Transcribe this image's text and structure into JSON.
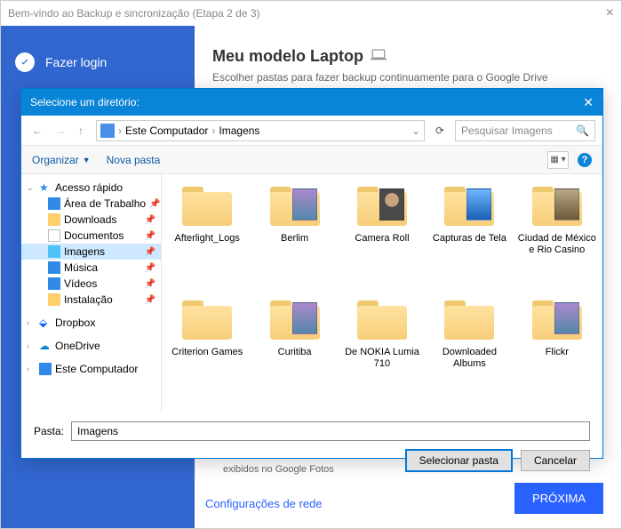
{
  "window": {
    "title": "Bem-vindo ao Backup e sincronização (Etapa 2 de 3)"
  },
  "sidebar": {
    "login_label": "Fazer login"
  },
  "main": {
    "title": "Meu modelo Laptop",
    "subtitle": "Escolher pastas para fazer backup continuamente para o Google Drive",
    "partial_text": "exibidos no Google Fotos",
    "network_link": "Configurações de rede",
    "next_button": "PRÓXIMA"
  },
  "dialog": {
    "title": "Selecione um diretório:",
    "breadcrumb": {
      "root": "Este Computador",
      "current": "Imagens"
    },
    "search_placeholder": "Pesquisar Imagens",
    "toolbar": {
      "organize": "Organizar",
      "new_folder": "Nova pasta"
    },
    "tree": {
      "quick_access": "Acesso rápido",
      "items": [
        {
          "label": "Área de Trabalho",
          "icon": "desktop"
        },
        {
          "label": "Downloads",
          "icon": "folder"
        },
        {
          "label": "Documentos",
          "icon": "docs"
        },
        {
          "label": "Imagens",
          "icon": "pictures"
        },
        {
          "label": "Música",
          "icon": "music"
        },
        {
          "label": "Vídeos",
          "icon": "video"
        },
        {
          "label": "Instalação",
          "icon": "folder"
        }
      ],
      "dropbox": "Dropbox",
      "onedrive": "OneDrive",
      "this_pc": "Este Computador"
    },
    "folders": [
      {
        "label": "Afterlight_Logs",
        "preview": false
      },
      {
        "label": "Berlim",
        "preview": true,
        "thumb": "photo"
      },
      {
        "label": "Camera Roll",
        "preview": true,
        "thumb": "face"
      },
      {
        "label": "Capturas de Tela",
        "preview": true,
        "thumb": "blue"
      },
      {
        "label": "Ciudad de México e Rio Casino",
        "preview": true,
        "thumb": "city"
      },
      {
        "label": "Criterion Games",
        "preview": false
      },
      {
        "label": "Curitiba",
        "preview": true,
        "thumb": "photo"
      },
      {
        "label": "De NOKIA Lumia 710",
        "preview": false
      },
      {
        "label": "Downloaded Albums",
        "preview": false
      },
      {
        "label": "Flickr",
        "preview": true,
        "thumb": "photo"
      }
    ],
    "footer": {
      "pasta_label": "Pasta:",
      "pasta_value": "Imagens",
      "select_button": "Selecionar pasta",
      "cancel_button": "Cancelar"
    }
  }
}
